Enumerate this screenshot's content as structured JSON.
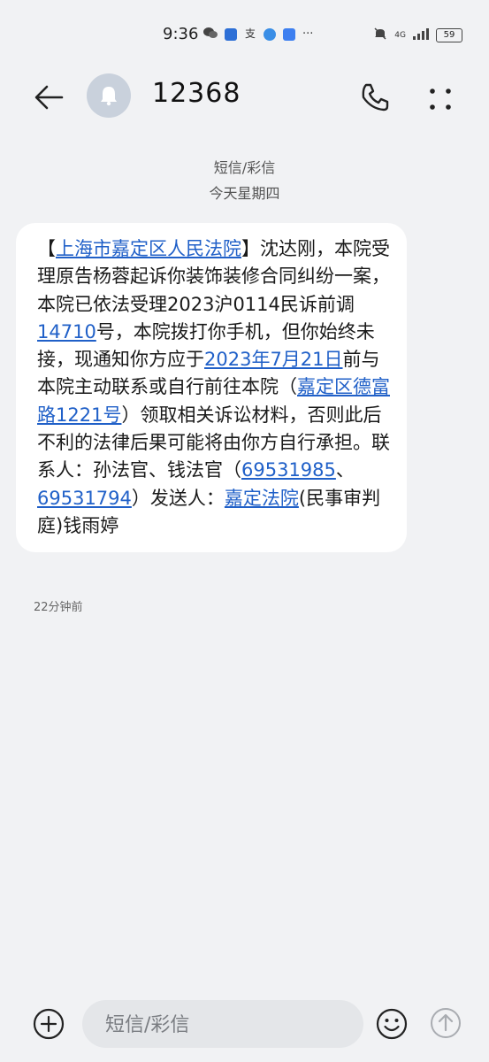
{
  "status_bar": {
    "time": "9:36",
    "network": "4G",
    "battery": "59",
    "more": "···"
  },
  "header": {
    "contact": "12368"
  },
  "conversation": {
    "type_label": "短信/彩信",
    "date_label": "今天星期四",
    "message": {
      "segments": [
        {
          "text": "【",
          "link": false
        },
        {
          "text": "上海市嘉定区人民法院",
          "link": true
        },
        {
          "text": "】沈达刚，本院受理原告杨蓉起诉你装饰装修合同纠纷一案，本院已依法受理2023沪0114民诉前调",
          "link": false
        },
        {
          "text": "14710",
          "link": true
        },
        {
          "text": "号，本院拨打你手机，但你始终未接，现通知你方应于",
          "link": false
        },
        {
          "text": "2023年7月21日",
          "link": true
        },
        {
          "text": "前与本院主动联系或自行前往本院（",
          "link": false
        },
        {
          "text": "嘉定区德富路1221号",
          "link": true
        },
        {
          "text": "）领取相关诉讼材料，否则此后不利的法律后果可能将由你方自行承担。联系人：孙法官、钱法官（",
          "link": false
        },
        {
          "text": "69531985",
          "link": true
        },
        {
          "text": "、",
          "link": false
        },
        {
          "text": "69531794",
          "link": true
        },
        {
          "text": "）发送人：",
          "link": false
        },
        {
          "text": "嘉定法院",
          "link": true
        },
        {
          "text": "(民事审判庭)钱雨婷",
          "link": false
        }
      ],
      "time": "22分钟前"
    }
  },
  "composer": {
    "placeholder": "短信/彩信"
  },
  "colors": {
    "background": "#f1f2f4",
    "bubble": "#ffffff",
    "link": "#2060c8"
  }
}
